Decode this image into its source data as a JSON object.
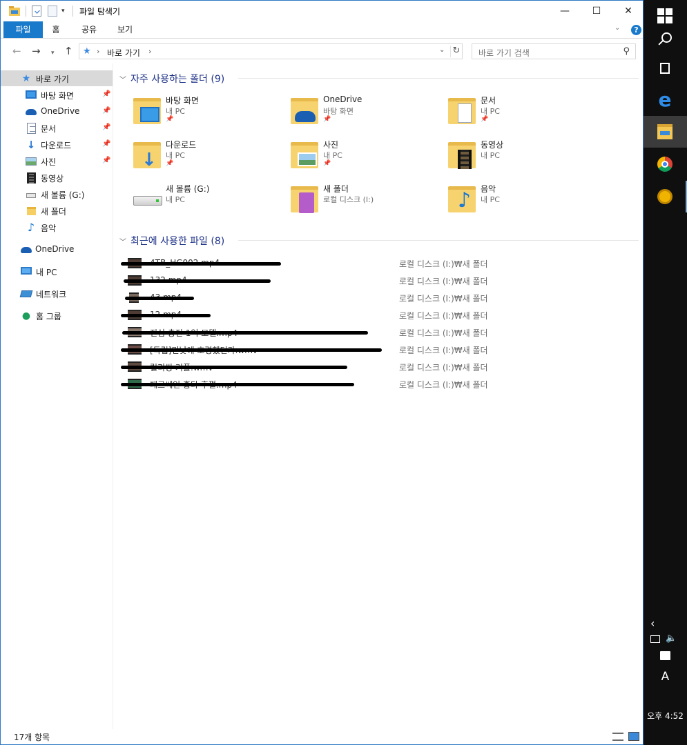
{
  "window": {
    "title": "파일 탐색기",
    "controls": {
      "minimize": "—",
      "maximize": "☐",
      "close": "✕"
    }
  },
  "ribbon": {
    "tabs": [
      {
        "label": "파일",
        "active": true
      },
      {
        "label": "홈"
      },
      {
        "label": "공유"
      },
      {
        "label": "보기"
      }
    ],
    "expand": "⌄",
    "help": "?"
  },
  "address": {
    "path": "바로 가기",
    "search_placeholder": "바로 가기 검색"
  },
  "nav_pane": {
    "items": [
      {
        "label": "바로 가기",
        "icon": "quick-access-star-icon",
        "selected": true
      },
      {
        "label": "바탕 화면",
        "icon": "desktop-icon",
        "pinned": true
      },
      {
        "label": "OneDrive",
        "icon": "onedrive-cloud-icon",
        "pinned": true
      },
      {
        "label": "문서",
        "icon": "documents-icon",
        "pinned": true
      },
      {
        "label": "다운로드",
        "icon": "downloads-arrow-icon",
        "pinned": true
      },
      {
        "label": "사진",
        "icon": "pictures-icon",
        "pinned": true
      },
      {
        "label": "동영상",
        "icon": "videos-film-icon"
      },
      {
        "label": "새 볼륨 (G:)",
        "icon": "drive-icon"
      },
      {
        "label": "새 폴더",
        "icon": "folder-icon"
      },
      {
        "label": "음악",
        "icon": "music-note-icon"
      },
      {
        "label": "OneDrive",
        "icon": "onedrive-cloud-icon"
      },
      {
        "label": "내 PC",
        "icon": "this-pc-icon"
      },
      {
        "label": "네트워크",
        "icon": "network-icon"
      },
      {
        "label": "홈 그룹",
        "icon": "homegroup-icon"
      }
    ]
  },
  "frequent": {
    "header": "자주 사용하는 폴더 (9)",
    "folders": [
      {
        "name": "바탕 화면",
        "location": "내 PC",
        "pinned": true,
        "icon": "desktop-folder-icon"
      },
      {
        "name": "OneDrive",
        "location": "바탕 화면",
        "pinned": true,
        "icon": "onedrive-folder-icon"
      },
      {
        "name": "문서",
        "location": "내 PC",
        "pinned": true,
        "icon": "documents-folder-icon"
      },
      {
        "name": "다운로드",
        "location": "내 PC",
        "pinned": true,
        "icon": "downloads-folder-icon"
      },
      {
        "name": "사진",
        "location": "내 PC",
        "pinned": true,
        "icon": "pictures-folder-icon"
      },
      {
        "name": "동영상",
        "location": "내 PC",
        "icon": "videos-folder-icon"
      },
      {
        "name": "새 볼륨 (G:)",
        "location": "내 PC",
        "icon": "drive-icon"
      },
      {
        "name": "새 폴더",
        "location": "로컬 디스크 (I:)",
        "icon": "media-folder-icon"
      },
      {
        "name": "음악",
        "location": "내 PC",
        "icon": "music-folder-icon"
      }
    ]
  },
  "recent": {
    "header": "최근에 사용한 파일 (8)",
    "files": [
      {
        "name": "4TB_HG002.mp4",
        "location": "로컬 디스크 (I:)₩새 폴더"
      },
      {
        "name": "132.mp4",
        "location": "로컬 디스크 (I:)₩새 폴더"
      },
      {
        "name": "43.mp4",
        "location": "로컬 디스크 (I:)₩새 폴더"
      },
      {
        "name": "12.mp4",
        "location": "로컬 디스크 (I:)₩새 폴더"
      },
      {
        "name": "진심 충전 1억 모델.mp4",
        "location": "로컬 디스크 (I:)₩새 폴더"
      },
      {
        "name": "[독립]민낯에 호령했던가.wmv",
        "location": "로컬 디스크 (I:)₩새 폴더"
      },
      {
        "name": "릴리쌍 커플.wmv",
        "location": "로컬 디스크 (I:)₩새 폴더"
      },
      {
        "name": "페르쎄인 홍타 후쩔.mp4",
        "location": "로컬 디스크 (I:)₩새 폴더"
      }
    ]
  },
  "status": {
    "item_count": "17개 항목"
  },
  "taskbar": {
    "ime": "A",
    "clock": "오후 4:52"
  },
  "colors": {
    "accent": "#1979ca",
    "group_header": "#1e3287",
    "selection": "#d9d9d9",
    "taskbar": "#0f0f0f"
  }
}
